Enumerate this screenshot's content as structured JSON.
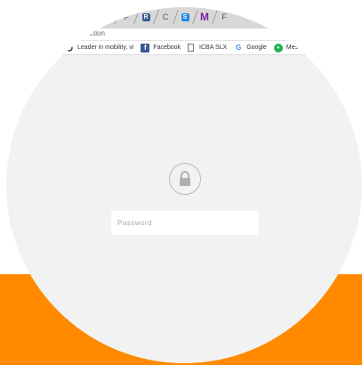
{
  "tab_strip": {
    "tabs": [
      {
        "glyph": "F",
        "color": "#999999"
      },
      {
        "glyph": "R",
        "color": "#3b5998"
      },
      {
        "glyph": "C",
        "color": "#999999"
      },
      {
        "glyph": "S",
        "color": "#1e88e5"
      },
      {
        "glyph": "M",
        "color": "#7b1fa2"
      },
      {
        "glyph": "F",
        "color": "#999999"
      }
    ]
  },
  "address_bar": {
    "text": "ction"
  },
  "bookmarks": [
    {
      "label": "Leader in mobility, vi",
      "icon": "refresh-icon"
    },
    {
      "label": "Facebook",
      "icon": "facebook-icon"
    },
    {
      "label": "ICBA SLX",
      "icon": "document-icon"
    },
    {
      "label": "Google",
      "icon": "google-icon"
    },
    {
      "label": "Message",
      "icon": "messages-icon"
    }
  ],
  "lock": {
    "icon": "lock-icon"
  },
  "password_input": {
    "placeholder": "Password",
    "value": ""
  },
  "colors": {
    "orange": "#ff8a00",
    "panel": "#f2f2f2"
  }
}
